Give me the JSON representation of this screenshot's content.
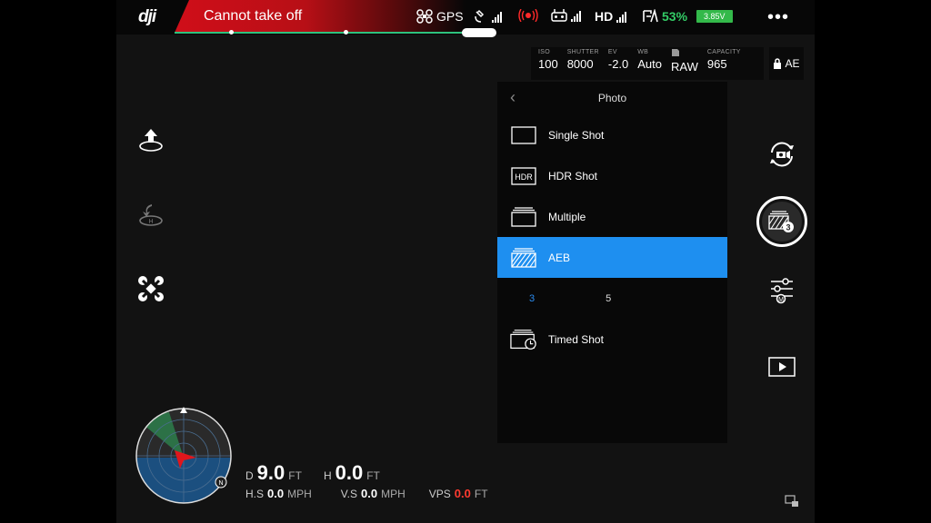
{
  "topbar": {
    "logo": "dji",
    "status": "Cannot take off",
    "gps_label": "GPS",
    "hd_label": "HD",
    "battery_percent": "53%",
    "voltage": "3.85V",
    "menu": "•••"
  },
  "camera_params": [
    {
      "label": "ISO",
      "value": "100"
    },
    {
      "label": "SHUTTER",
      "value": "8000"
    },
    {
      "label": "EV",
      "value": "-2.0"
    },
    {
      "label": "WB",
      "value": "Auto"
    },
    {
      "label": "",
      "value": "RAW"
    },
    {
      "label": "CAPACITY",
      "value": "965"
    }
  ],
  "ae_lock": "AE",
  "photo_panel": {
    "title": "Photo",
    "modes": [
      {
        "label": "Single Shot",
        "icon": "single-shot-icon"
      },
      {
        "label": "HDR Shot",
        "icon": "hdr-icon",
        "icon_text": "HDR"
      },
      {
        "label": "Multiple",
        "icon": "multiple-icon"
      },
      {
        "label": "AEB",
        "icon": "aeb-icon",
        "active": true
      },
      {
        "label": "Timed Shot",
        "icon": "timed-shot-icon"
      }
    ],
    "aeb_options": [
      "3",
      "5"
    ],
    "aeb_selected": "3"
  },
  "shutter_badge": "3",
  "telemetry": {
    "d_label": "D",
    "d_value": "9.0",
    "d_unit": "FT",
    "h_label": "H",
    "h_value": "0.0",
    "h_unit": "FT",
    "hs_label": "H.S",
    "hs_value": "0.0",
    "hs_unit": "MPH",
    "vs_label": "V.S",
    "vs_value": "0.0",
    "vs_unit": "MPH",
    "vps_label": "VPS",
    "vps_value": "0.0",
    "vps_unit": "FT"
  },
  "radar": {
    "north": "N"
  },
  "colors": {
    "accent": "#1e8ff0",
    "danger": "#d00e19",
    "battery": "#33cc66"
  }
}
